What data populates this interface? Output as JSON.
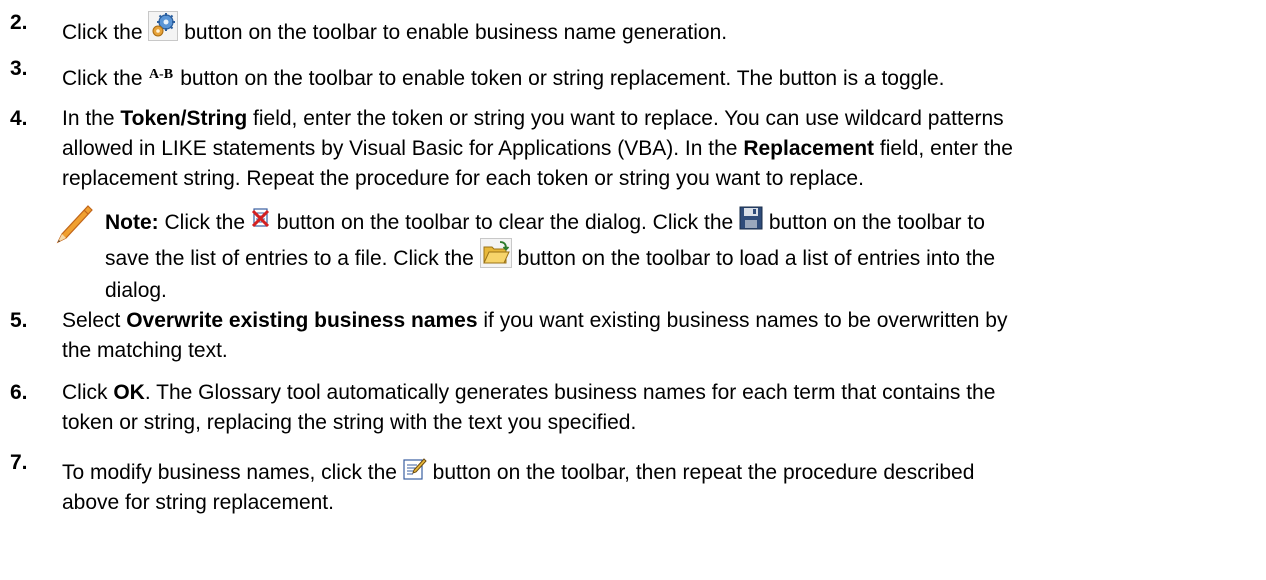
{
  "steps": [
    {
      "num": "2.",
      "pre": "Click the",
      "post": "button on the toolbar to enable business name generation."
    },
    {
      "num": "3.",
      "pre": "Click the",
      "post": "button on the toolbar to enable token or string replacement. The button is a toggle."
    },
    {
      "num": "4.",
      "p1": "In the",
      "b1": "Token/String",
      "p2": "field, enter the token or string you want to replace. You can use wildcard patterns",
      "line2a": "allowed in LIKE statements by Visual Basic for Applications (VBA). In the",
      "b2": "Replacement",
      "line2b": "field, enter the",
      "line3": "replacement string. Repeat the procedure for each token or string you want to replace."
    },
    {
      "num": "5.",
      "p1": "Select",
      "b1": "Overwrite existing business names",
      "p2": "if you want existing business names to be overwritten by",
      "line2": "the matching text."
    },
    {
      "num": "6.",
      "p1": "Click",
      "b1": "OK",
      "p2": ". The Glossary tool automatically generates business names for each term that contains the",
      "line2": "token or string, replacing the string with the text you specified."
    },
    {
      "num": "7.",
      "pre": "To modify business names, click the",
      "post": "button on the toolbar, then repeat the procedure described",
      "line2": "above for string replacement."
    }
  ],
  "note": {
    "label": "Note:",
    "t1": "Click the",
    "t2": "button on the toolbar to clear the dialog. Click the",
    "t3": "button on the toolbar to",
    "t4": "save the list of entries to a file. Click the",
    "t5": "button on the toolbar to load a list of entries into the",
    "t6": "dialog."
  },
  "icons": {
    "generate": "gear-generate-icon",
    "replace": "replace-a-b-icon",
    "replace_text": "A-B",
    "clear": "clear-dialog-icon",
    "save": "save-floppy-icon",
    "load": "open-folder-icon",
    "modify": "edit-modify-icon",
    "note": "pencil-note-icon"
  }
}
